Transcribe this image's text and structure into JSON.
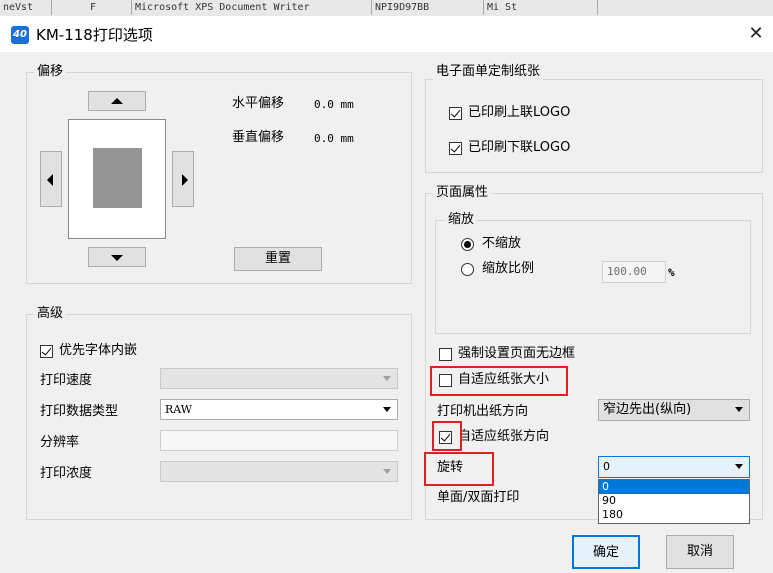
{
  "background_tabs": [
    "neVst",
    "F",
    "Microsoft XPS Document Writer",
    "NPI9D97BB",
    "Mi   St"
  ],
  "window": {
    "title": "KM-118打印选项",
    "icon_text": "40"
  },
  "offset": {
    "group_label": "偏移",
    "horizontal_label": "水平偏移",
    "horizontal_value": "0.0 mm",
    "vertical_label": "垂直偏移",
    "vertical_value": "0.0 mm",
    "reset_label": "重置"
  },
  "advanced": {
    "group_label": "高级",
    "prefer_embedded_font_label": "优先字体内嵌",
    "prefer_embedded_font_checked": true,
    "print_speed_label": "打印速度",
    "print_speed_value": "",
    "print_data_type_label": "打印数据类型",
    "print_data_type_value": "RAW",
    "resolution_label": "分辨率",
    "resolution_value": "",
    "print_density_label": "打印浓度",
    "print_density_value": ""
  },
  "custom_paper": {
    "group_label": "电子面单定制纸张",
    "top_logo_label": "已印刷上联LOGO",
    "top_logo_checked": true,
    "bottom_logo_label": "已印刷下联LOGO",
    "bottom_logo_checked": true
  },
  "page_properties": {
    "group_label": "页面属性",
    "scale_group_label": "缩放",
    "no_scale_label": "不缩放",
    "no_scale_selected": true,
    "scale_ratio_label": "缩放比例",
    "scale_ratio_value": "100.00",
    "scale_ratio_unit": "%"
  },
  "options": {
    "borderless_label": "强制设置页面无边框",
    "borderless_checked": false,
    "fit_paper_size_label": "自适应纸张大小",
    "fit_paper_size_checked": false,
    "paper_out_direction_label": "打印机出纸方向",
    "paper_out_direction_value": "窄边先出(纵向)",
    "fit_paper_direction_label": "自适应纸张方向",
    "fit_paper_direction_checked": true,
    "rotation_label": "旋转",
    "rotation_value": "0",
    "rotation_options": [
      "0",
      "90",
      "180"
    ],
    "duplex_label": "单面/双面打印"
  },
  "buttons": {
    "ok_label": "确定",
    "cancel_label": "取消"
  },
  "colors": {
    "highlight_red": "#e02020",
    "accent_blue": "#0078d7",
    "selection_blue": "#0078d7"
  }
}
